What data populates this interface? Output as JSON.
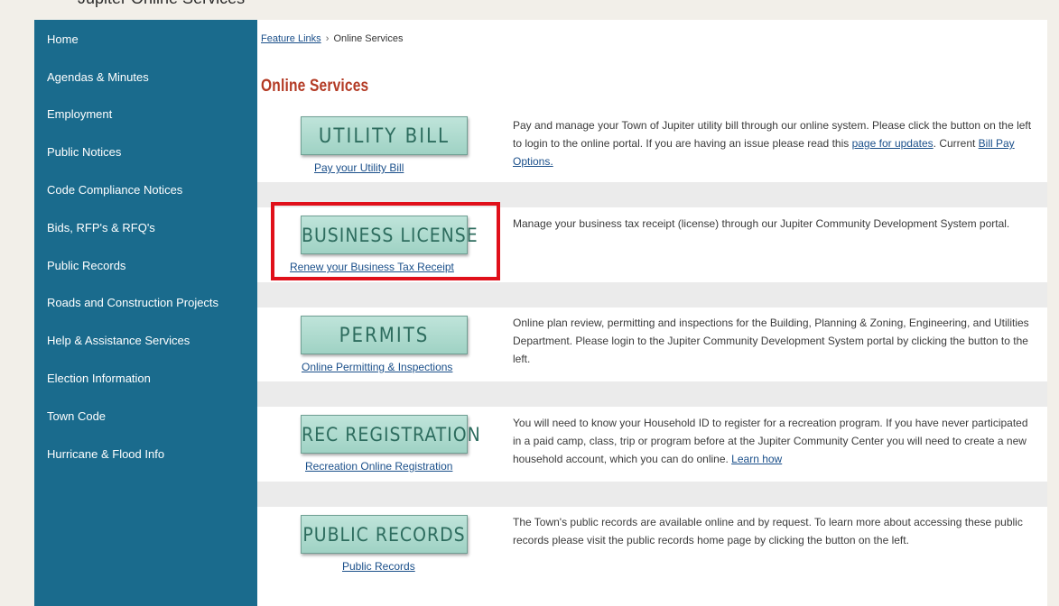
{
  "header": {
    "partial_text": "Jupiter Online Services"
  },
  "sidebar": {
    "items": [
      {
        "label": "Home"
      },
      {
        "label": "Agendas & Minutes"
      },
      {
        "label": "Employment"
      },
      {
        "label": "Public Notices"
      },
      {
        "label": "Code Compliance Notices"
      },
      {
        "label": "Bids, RFP's & RFQ's"
      },
      {
        "label": "Public Records"
      },
      {
        "label": "Roads and Construction Projects"
      },
      {
        "label": "Help & Assistance Services"
      },
      {
        "label": "Election Information"
      },
      {
        "label": "Town Code"
      },
      {
        "label": "Hurricane & Flood Info"
      }
    ]
  },
  "breadcrumb": {
    "parent": "Feature Links",
    "separator": "›",
    "current": "Online Services"
  },
  "page": {
    "title": "Online Services"
  },
  "services": [
    {
      "button_label": "UTILITY BILL",
      "link_label": "Pay your Utility Bill",
      "desc_part1": "Pay and manage your Town of Jupiter utility bill through our online system. Please click the button on the left to login to the online portal. If you are having an issue please read this ",
      "desc_link1": "page for updates",
      "desc_part2": ".  Current ",
      "desc_link2": "Bill Pay Options."
    },
    {
      "button_label": "BUSINESS LICENSE",
      "link_label": "Renew your Business Tax Receipt",
      "desc": "Manage your business tax receipt (license) through our Jupiter Community Development System portal."
    },
    {
      "button_label": "PERMITS",
      "link_label": "Online Permitting & Inspections",
      "desc": "Online plan review, permitting and inspections for the Building, Planning & Zoning, Engineering, and Utilities Department. Please login to the Jupiter Community Development System portal by clicking the button to the left."
    },
    {
      "button_label": "REC REGISTRATION",
      "link_label": "Recreation Online Registration",
      "desc_part1": "You will need to know your Household ID to register for a recreation program. If you have never participated in a paid camp, class, trip or program before at the Jupiter Community Center you will need to create a new household account, which you can do online. ",
      "desc_link1": "Learn how"
    },
    {
      "button_label": "PUBLIC RECORDS",
      "link_label": "Public Records",
      "desc": "The Town's public records are available online and by request. To learn more about accessing these public records please visit the public records home page by clicking the button on the left."
    }
  ],
  "colors": {
    "sidebar_bg": "#1a6b8d",
    "title_red": "#b33a24",
    "button_green": "#9fd2c4",
    "link_blue": "#1a4f8a",
    "highlight_red": "#e0101a"
  }
}
